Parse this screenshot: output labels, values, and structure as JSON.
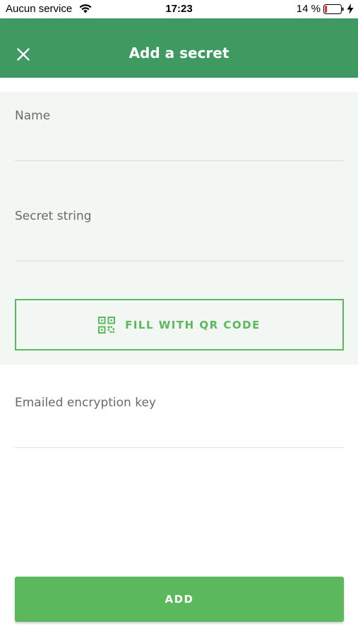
{
  "status_bar": {
    "carrier": "Aucun service",
    "time": "17:23",
    "battery_percent": "14 %",
    "battery_level": 0.14,
    "icons": [
      "wifi-icon",
      "battery-icon",
      "charging-bolt-icon"
    ]
  },
  "app_bar": {
    "title": "Add a secret",
    "close_icon": "close-icon",
    "color": "#3f9a62"
  },
  "form": {
    "name": {
      "label": "Name",
      "value": "",
      "placeholder": ""
    },
    "secret_string": {
      "label": "Secret string",
      "value": "",
      "placeholder": ""
    },
    "qr_button": {
      "label": "FILL WITH QR CODE",
      "icon": "qr-code-icon"
    },
    "encryption_key": {
      "label": "Emailed encryption key",
      "value": "",
      "placeholder": ""
    }
  },
  "actions": {
    "add_label": "ADD"
  },
  "colors": {
    "primary": "#3f9a62",
    "accent": "#5cb85c",
    "section_background": "#f2f7f4"
  }
}
